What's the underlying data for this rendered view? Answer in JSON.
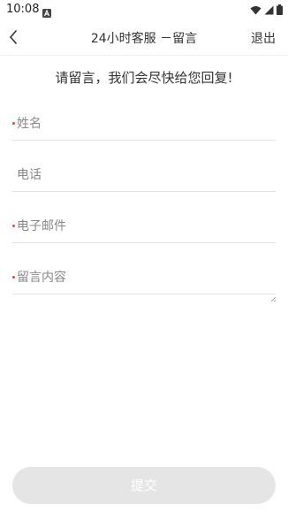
{
  "status_bar": {
    "time": "10:08",
    "notification_icon": "a-notification-icon",
    "icons": [
      "wifi-icon",
      "signal-icon",
      "battery-icon"
    ]
  },
  "header": {
    "back_icon": "chevron-left-icon",
    "title": "24小时客服 －留言",
    "exit_label": "退出"
  },
  "prompt": "请留言，我们会尽快给您回复!",
  "form": {
    "name": {
      "placeholder": "姓名",
      "required": true,
      "value": ""
    },
    "phone": {
      "placeholder": "电话",
      "required": false,
      "value": ""
    },
    "email": {
      "placeholder": "电子邮件",
      "required": true,
      "value": ""
    },
    "message": {
      "placeholder": "留言内容",
      "required": true,
      "value": ""
    }
  },
  "submit_label": "提交",
  "colors": {
    "required_mark": "#e0483e",
    "submit_bg": "#e5e5e5",
    "submit_text": "#ffffff",
    "divider": "#e2e2e2"
  }
}
